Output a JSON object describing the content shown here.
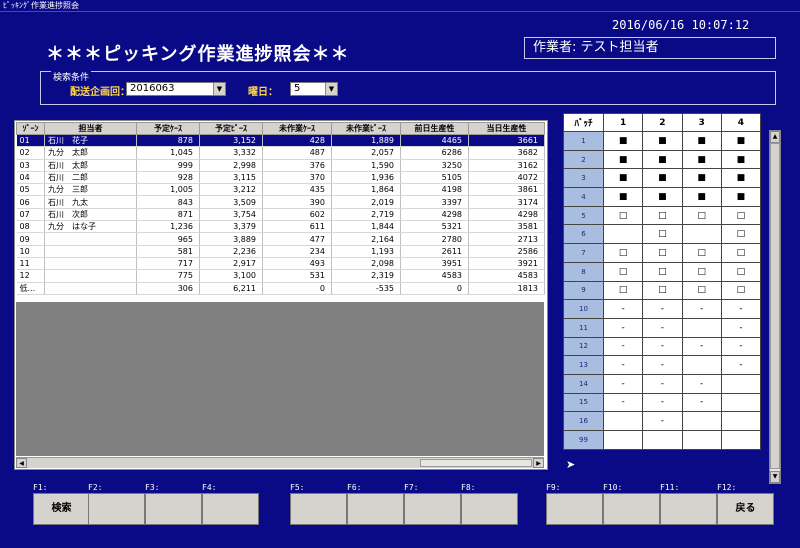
{
  "window": {
    "title": "ﾋﾟｯｷﾝｸﾞ作業進捗照会"
  },
  "header": {
    "datetime": "2016/06/16 10:07:12",
    "app_title": "＊＊＊ピッキング作業進捗照会＊＊",
    "operator": "作業者: テスト担当者"
  },
  "search": {
    "group_title": "検索条件",
    "plan_label": "配送企画回：",
    "plan_value": "2016063",
    "weekday_label": "曜日：",
    "weekday_value": "5"
  },
  "table": {
    "columns": [
      "ｿﾞｰﾝ",
      "担当者",
      "予定ｹｰｽ",
      "予定ﾋﾟｰｽ",
      "未作業ｹｰｽ",
      "未作業ﾋﾟｰｽ",
      "前日生産性",
      "当日生産性"
    ],
    "rows": [
      [
        "01",
        "石川　花子",
        "878",
        "3,152",
        "428",
        "1,889",
        "4465",
        "3661"
      ],
      [
        "02",
        "九分　太郎",
        "1,045",
        "3,332",
        "487",
        "2,057",
        "6286",
        "3682"
      ],
      [
        "03",
        "石川　太郎",
        "999",
        "2,998",
        "376",
        "1,590",
        "3250",
        "3162"
      ],
      [
        "04",
        "石川　二郎",
        "928",
        "3,115",
        "370",
        "1,936",
        "5105",
        "4072"
      ],
      [
        "05",
        "九分　三郎",
        "1,005",
        "3,212",
        "435",
        "1,864",
        "4198",
        "3861"
      ],
      [
        "06",
        "石川　九太",
        "843",
        "3,509",
        "390",
        "2,019",
        "3397",
        "3174"
      ],
      [
        "07",
        "石川　次郎",
        "871",
        "3,754",
        "602",
        "2,719",
        "4298",
        "4298"
      ],
      [
        "08",
        "九分　はな子",
        "1,236",
        "3,379",
        "611",
        "1,844",
        "5321",
        "3581"
      ],
      [
        "09",
        "",
        "965",
        "3,889",
        "477",
        "2,164",
        "2780",
        "2713"
      ],
      [
        "10",
        "",
        "581",
        "2,236",
        "234",
        "1,193",
        "2611",
        "2586"
      ],
      [
        "11",
        "",
        "717",
        "2,917",
        "493",
        "2,098",
        "3951",
        "3921"
      ],
      [
        "12",
        "",
        "775",
        "3,100",
        "531",
        "2,319",
        "4583",
        "4583"
      ],
      [
        "低...",
        "",
        "306",
        "6,211",
        "0",
        "-535",
        "0",
        "1813"
      ]
    ]
  },
  "batch": {
    "columns": [
      "ﾊﾞｯﾁ",
      "1",
      "2",
      "3",
      "4"
    ],
    "rows": [
      [
        "1",
        "■",
        "■",
        "■",
        "■"
      ],
      [
        "2",
        "■",
        "■",
        "■",
        "■"
      ],
      [
        "3",
        "■",
        "■",
        "■",
        "■"
      ],
      [
        "4",
        "■",
        "■",
        "■",
        "■"
      ],
      [
        "5",
        "□",
        "□",
        "□",
        "□"
      ],
      [
        "6",
        "",
        "□",
        "",
        "□"
      ],
      [
        "7",
        "□",
        "□",
        "□",
        "□"
      ],
      [
        "8",
        "□",
        "□",
        "□",
        "□"
      ],
      [
        "9",
        "□",
        "□",
        "□",
        "□"
      ],
      [
        "10",
        "-",
        "-",
        "-",
        "-"
      ],
      [
        "11",
        "-",
        "-",
        "",
        "-"
      ],
      [
        "12",
        "-",
        "-",
        "-",
        "-"
      ],
      [
        "13",
        "-",
        "-",
        "",
        "-"
      ],
      [
        "14",
        "-",
        "-",
        "-",
        ""
      ],
      [
        "15",
        "-",
        "-",
        "-",
        ""
      ],
      [
        "16",
        "",
        "-",
        "",
        ""
      ],
      [
        "99",
        "",
        "",
        "",
        ""
      ]
    ]
  },
  "fkeys": [
    {
      "key": "F1:",
      "label": "検索"
    },
    {
      "key": "F2:",
      "label": ""
    },
    {
      "key": "F3:",
      "label": ""
    },
    {
      "key": "F4:",
      "label": ""
    },
    {
      "key": "F5:",
      "label": ""
    },
    {
      "key": "F6:",
      "label": ""
    },
    {
      "key": "F7:",
      "label": ""
    },
    {
      "key": "F8:",
      "label": ""
    },
    {
      "key": "F9:",
      "label": ""
    },
    {
      "key": "F10:",
      "label": ""
    },
    {
      "key": "F11:",
      "label": ""
    },
    {
      "key": "F12:",
      "label": "戻る"
    }
  ]
}
